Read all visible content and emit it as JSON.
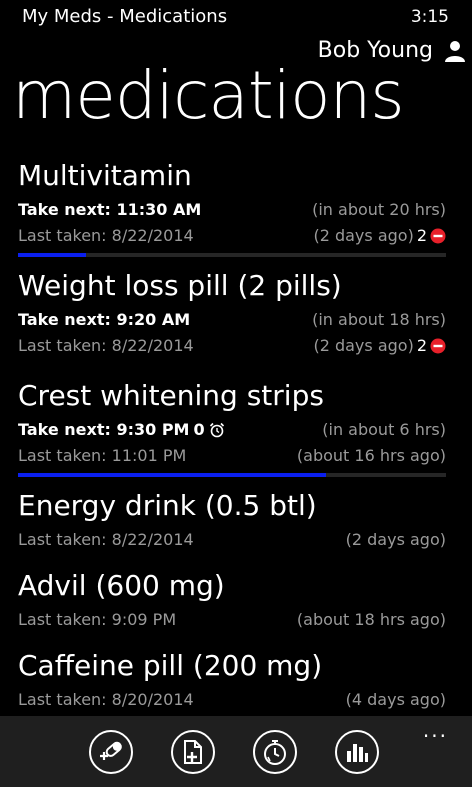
{
  "status_bar": {
    "app_title": "My Meds - Medications",
    "time": "3:15"
  },
  "user": {
    "name": "Bob Young",
    "icon": "person-icon"
  },
  "page_title": "medications",
  "colors": {
    "background": "#000000",
    "accent": "#0a1ff0",
    "muted_text": "#9a9a9a",
    "app_bar": "#1f1f1f",
    "stop_red": "#e8202a"
  },
  "medications": [
    {
      "name": "Multivitamin",
      "take_next": "Take next: 11:30 AM",
      "take_next_rel": "(in about 20 hrs)",
      "last_taken": "Last taken: 8/22/2014",
      "last_taken_rel": "(2 days ago)",
      "missed_count": "2",
      "progress": 0.16
    },
    {
      "name": "Weight loss pill (2 pills)",
      "take_next": "Take next: 9:20 AM",
      "take_next_rel": "(in about 18 hrs)",
      "last_taken": "Last taken: 8/22/2014",
      "last_taken_rel": "(2 days ago)",
      "missed_count": "2"
    },
    {
      "name": "Crest whitening strips",
      "take_next": "Take next: 9:30 PM",
      "alarm_count": "0",
      "take_next_rel": "(in about 6 hrs)",
      "last_taken": "Last taken: 11:01 PM",
      "last_taken_rel": "(about 16 hrs ago)",
      "progress": 0.72
    },
    {
      "name": "Energy drink (0.5 btl)",
      "last_taken": "Last taken: 8/22/2014",
      "last_taken_rel": "(2 days ago)"
    },
    {
      "name": "Advil (600 mg)",
      "last_taken": "Last taken: 9:09 PM",
      "last_taken_rel": "(about 18 hrs ago)"
    },
    {
      "name": "Caffeine pill (200 mg)",
      "last_taken": "Last taken: 8/20/2014",
      "last_taken_rel": "(4 days ago)"
    }
  ],
  "app_bar": {
    "buttons": [
      {
        "icon": "take-pill-icon"
      },
      {
        "icon": "add-medication-icon"
      },
      {
        "icon": "reminder-timer-icon"
      },
      {
        "icon": "history-chart-icon"
      }
    ],
    "more": "..."
  }
}
